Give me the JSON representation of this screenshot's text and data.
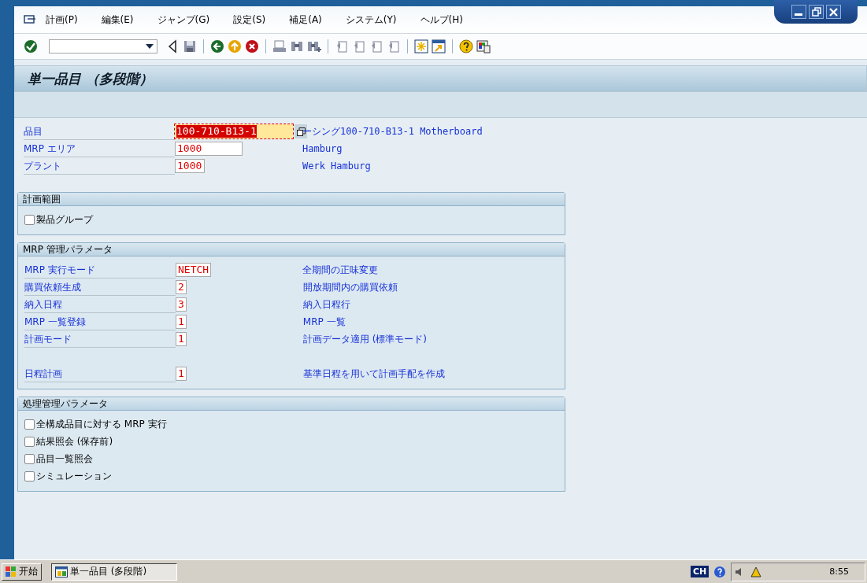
{
  "menu": [
    "計画(P)",
    "編集(E)",
    "ジャンプ(G)",
    "設定(S)",
    "補足(A)",
    "システム(Y)",
    "ヘルプ(H)"
  ],
  "title": "単一品目 （多段階）",
  "header_fields": [
    {
      "label": "品目",
      "value": "100-710-B13-1",
      "focused": true,
      "description": "ーシング100-710-B13-1 Motherboard"
    },
    {
      "label": "MRP エリア",
      "value": "1000",
      "focused": false,
      "description": "Hamburg"
    },
    {
      "label": "プラント",
      "value": "1000",
      "focused": false,
      "description": "Werk Hamburg"
    }
  ],
  "groups": [
    {
      "title": "計画範囲",
      "kind": "checks",
      "checkboxes": [
        {
          "label": "製品グループ",
          "checked": false
        }
      ]
    },
    {
      "title": "MRP 管理パラメータ",
      "kind": "params",
      "row_blocks": [
        [
          {
            "label": "MRP 実行モード",
            "value": "NETCH",
            "description": "全期間の正味変更"
          },
          {
            "label": "購買依頼生成",
            "value": "2",
            "description": "開放期間内の購買依頼"
          },
          {
            "label": "納入日程",
            "value": "3",
            "description": "納入日程行"
          },
          {
            "label": "MRP 一覧登録",
            "value": "1",
            "description": "MRP 一覧"
          },
          {
            "label": "計画モード",
            "value": "1",
            "description": "計画データ適用 (標準モード)"
          }
        ],
        [
          {
            "label": "日程計画",
            "value": "1",
            "description": "基準日程を用いて計画手配を作成"
          }
        ]
      ]
    },
    {
      "title": "処理管理パラメータ",
      "kind": "checks",
      "checkboxes": [
        {
          "label": "全構成品目に対する MRP 実行",
          "checked": false
        },
        {
          "label": "結果照会 (保存前)",
          "checked": false
        },
        {
          "label": "品目一覧照会",
          "checked": false
        },
        {
          "label": "シミュレーション",
          "checked": false
        }
      ]
    }
  ],
  "taskbar": {
    "start": "开始",
    "task": "単一品目 (多段階)",
    "language": "CH",
    "clock": "8:55"
  }
}
